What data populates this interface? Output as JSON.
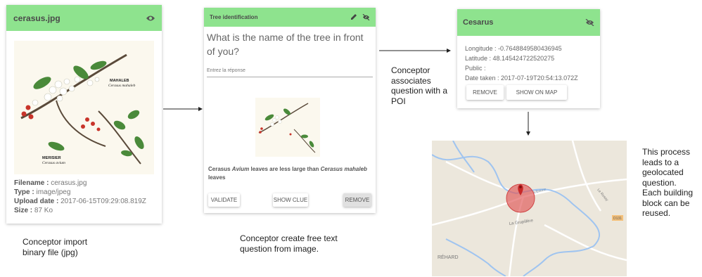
{
  "card1": {
    "title": "cerasus.jpg",
    "icon": "eye-icon",
    "image_labels": {
      "mahaleb": "MAHALEB",
      "mahaleb_latin": "Cerasus mahaleb",
      "merisier": "MERISIER",
      "merisier_latin": "Cerasus avium"
    },
    "meta": [
      {
        "key": "Filename",
        "value": "cerasus.jpg"
      },
      {
        "key": "Type",
        "value": "image/jpeg"
      },
      {
        "key": "Upload date",
        "value": "2017-06-15T09:29:08.819Z"
      },
      {
        "key": "Size",
        "value": "87 Ko"
      }
    ]
  },
  "caption1": {
    "line1": "Conceptor import",
    "line2": "binary file (jpg)"
  },
  "card2": {
    "title": "Tree identification",
    "question_line1": "What is the name of the tree in front",
    "question_line2": "of you?",
    "answer_placeholder": "Entrez la réponse",
    "clue_parts": [
      "Cerasus ",
      "Avium",
      " leaves are less large than ",
      "Cerasus mahaleb"
    ],
    "clue_line2": "leaves",
    "buttons": {
      "validate": "VALIDATE",
      "show_clue": "SHOW CLUE",
      "remove": "REMOVE"
    }
  },
  "caption2": {
    "line1": "Conceptor create free text",
    "line2": "question from image."
  },
  "caption3": {
    "lines": [
      "Conceptor",
      "associates",
      "question with a",
      "POI"
    ]
  },
  "card3": {
    "title": "Cesarus",
    "fields": [
      "Longitude : -0.7648849580436945",
      "Latitude : 48.145424722520275",
      "Public :",
      "Date taken : 2017-07-19T20:54:13.072Z"
    ],
    "buttons": {
      "remove": "REMOVE",
      "show_on_map": "SHOW ON MAP"
    }
  },
  "map": {
    "labels": {
      "rehard": "RÉHARD",
      "grupillere": "La Grupillère",
      "rosay": "Le Rosay",
      "erinne": "L'Erinne",
      "road": "D131"
    }
  },
  "caption4": {
    "lines": [
      "This process",
      "leads to a",
      "geolocated",
      "question.",
      "Each building",
      "block can be",
      "reused."
    ]
  },
  "colors": {
    "header_green": "#8ee38e",
    "map_bg": "#ece7dc",
    "river": "#9fc4f0",
    "marker": "#e05555"
  }
}
